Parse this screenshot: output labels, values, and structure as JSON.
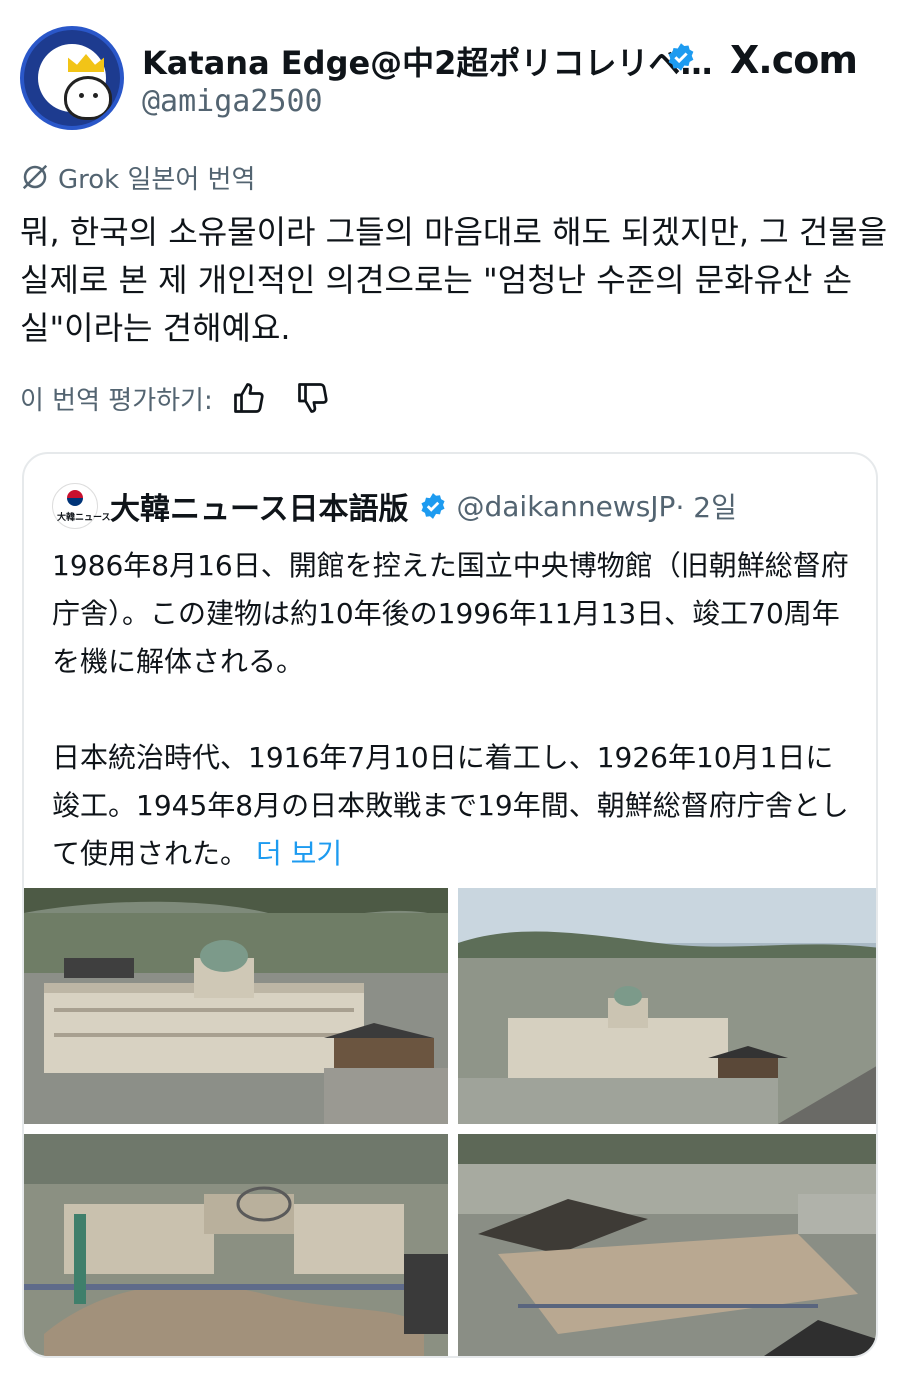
{
  "author": {
    "display_name": "Katana Edge@中2超ポリコレリベ…",
    "handle": "@amiga2500",
    "verified_icon": "verified-badge-icon",
    "avatar_icon": "crowned-cartoon-avatar"
  },
  "site": {
    "label": "X.com"
  },
  "translation": {
    "label": "Grok 일본어 번역",
    "text": "뭐, 한국의 소유물이라 그들의 마음대로 해도 되겠지만, 그 건물을 실제로 본 제 개인적인 의견으로는 \"엄청난 수준의 문화유산 손실\"이라는 견해예요.",
    "rate_label": "이 번역 평가하기:"
  },
  "quote": {
    "name": "大韓ニュース日本語版",
    "handle": "@daikannewsJP",
    "time": "· 2일",
    "logo_text": "大韓ニュース",
    "paragraph1": "1986年8月16日、開館を控えた国立中央博物館（旧朝鮮総督府庁舎）。この建物は約10年後の1996年11月13日、竣工70周年を機に解体される。",
    "paragraph2": "日本統治時代、1916年7月10日に着工し、1926年10月1日に竣工。1945年8月の日本敗戦まで19年間、朝鮮総督府庁舎として使用された。",
    "more_label": "더 보기"
  },
  "colors": {
    "text": "#0f1419",
    "secondary": "#536471",
    "link": "#1d9bf0",
    "border": "#e6e9eb"
  }
}
